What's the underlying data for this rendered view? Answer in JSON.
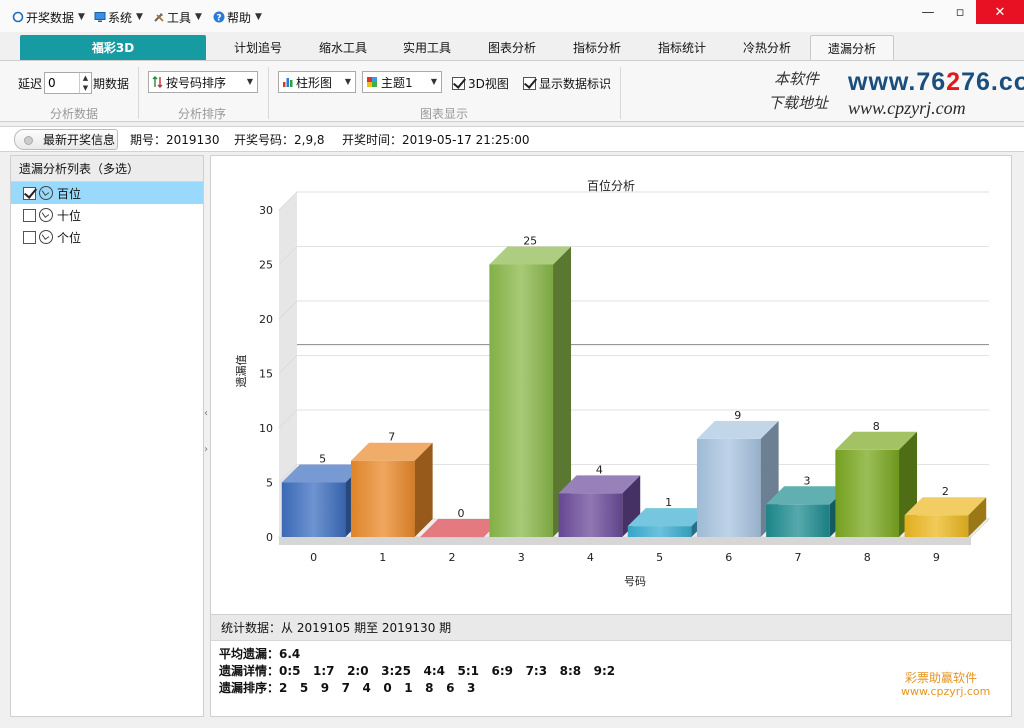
{
  "menu": {
    "items": [
      {
        "label": "开奖数据",
        "icon": "circle-icon"
      },
      {
        "label": "系统",
        "icon": "monitor-icon"
      },
      {
        "label": "工具",
        "icon": "tools-icon"
      },
      {
        "label": "帮助",
        "icon": "help-icon"
      }
    ]
  },
  "window": {
    "minimize": "—",
    "maximize": "▫",
    "close": "✕"
  },
  "tabs": {
    "home": "福彩3D",
    "items": [
      "计划追号",
      "缩水工具",
      "实用工具",
      "图表分析",
      "指标分析",
      "指标统计",
      "冷热分析",
      "遗漏分析"
    ],
    "active": "遗漏分析"
  },
  "ribbon": {
    "delay_label": "延迟",
    "delay_value": "0",
    "period_label": "期数据",
    "group1": "分析数据",
    "sort_combo": "按号码排序",
    "group2": "分析排序",
    "chart_type": "柱形图",
    "theme": "主题1",
    "view3d": "3D视图",
    "show_labels": "显示数据标识",
    "group3": "图表显示"
  },
  "watermark": {
    "cn_line1": "本软件",
    "cn_line2": "下载地址",
    "url_a": "www.76",
    "url_hl": "2",
    "url_b": "76.com",
    "url2": "www.cpzyrj.com"
  },
  "info": {
    "button": "最新开奖信息",
    "period_label": "期号：",
    "period": "2019130",
    "numbers_label": "开奖号码：",
    "numbers": "2,9,8",
    "time_label": "开奖时间：",
    "time": "2019-05-17 21:25:00"
  },
  "left_panel": {
    "header": "遗漏分析列表（多选）",
    "items": [
      {
        "label": "百位",
        "checked": true
      },
      {
        "label": "十位",
        "checked": false
      },
      {
        "label": "个位",
        "checked": false
      }
    ]
  },
  "chart_data": {
    "type": "bar",
    "title": "百位分析",
    "xlabel": "号码",
    "ylabel": "遗漏值",
    "categories": [
      "0",
      "1",
      "2",
      "3",
      "4",
      "5",
      "6",
      "7",
      "8",
      "9"
    ],
    "values": [
      5,
      7,
      0,
      25,
      4,
      1,
      9,
      3,
      8,
      2
    ],
    "ylim": [
      0,
      30
    ],
    "yticks": [
      0,
      5,
      10,
      15,
      20,
      25,
      30
    ],
    "average_line": 16,
    "grid": true,
    "colors": [
      "#3e6fc0",
      "#ea8a2a",
      "#d8404a",
      "#8ab84a",
      "#6b4b9a",
      "#3aaed0",
      "#a8c4e0",
      "#1d8c90",
      "#7aa820",
      "#ecb820"
    ]
  },
  "stats": {
    "header": "统计数据：从 2019105 期至 2019130 期",
    "avg": "平均遗漏：6.4",
    "detail": "遗漏详情：0:5   1:7   2:0   3:25   4:4   5:1   6:9   7:3   8:8   9:2",
    "order": "遗漏排序：2   5   9   7   4   0   1   8   6   3",
    "brand1": "彩票助赢软件",
    "brand2": "www.cpzyrj.com"
  }
}
